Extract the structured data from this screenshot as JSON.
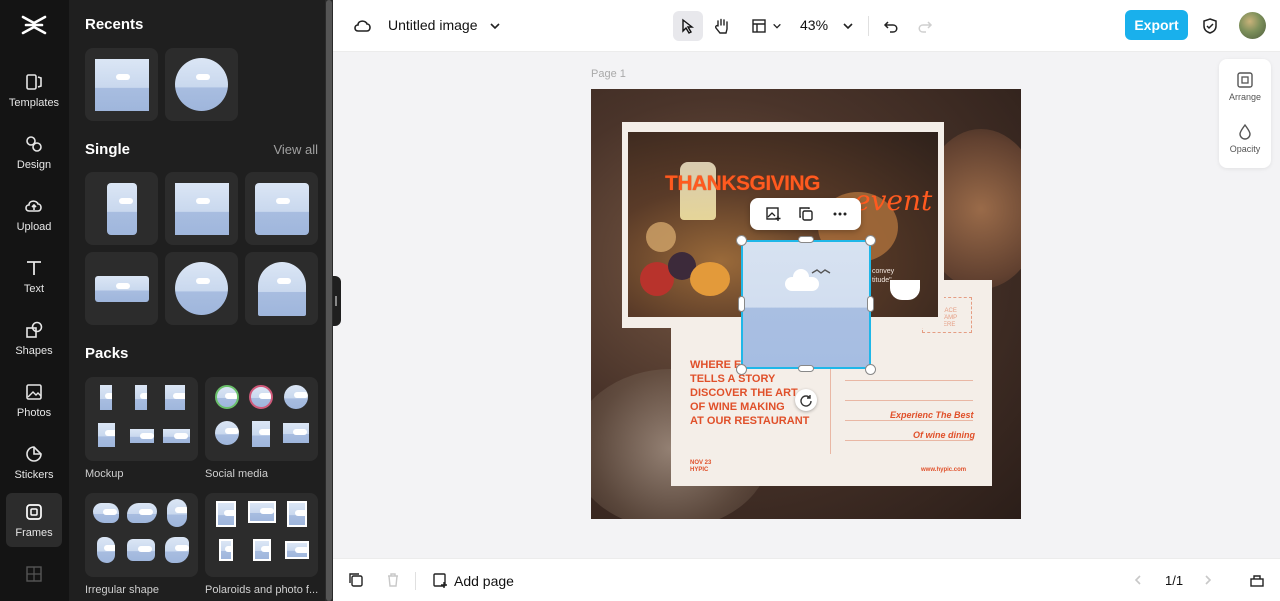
{
  "rail": {
    "items": [
      {
        "label": "Templates",
        "icon": "templates-icon"
      },
      {
        "label": "Design",
        "icon": "design-icon"
      },
      {
        "label": "Upload",
        "icon": "upload-icon"
      },
      {
        "label": "Text",
        "icon": "text-icon"
      },
      {
        "label": "Shapes",
        "icon": "shapes-icon"
      },
      {
        "label": "Photos",
        "icon": "photos-icon"
      },
      {
        "label": "Stickers",
        "icon": "stickers-icon"
      },
      {
        "label": "Frames",
        "icon": "frames-icon"
      }
    ],
    "active": "Frames"
  },
  "panel": {
    "recents_title": "Recents",
    "single_title": "Single",
    "single_view_all": "View all",
    "packs_title": "Packs",
    "packs": [
      {
        "label": "Mockup"
      },
      {
        "label": "Social media"
      },
      {
        "label": "Irregular shape"
      },
      {
        "label": "Polaroids and photo f..."
      }
    ]
  },
  "topbar": {
    "doc_title": "Untitled image",
    "zoom": "43%",
    "export_label": "Export"
  },
  "canvas": {
    "page_label": "Page 1",
    "design": {
      "headline": "THANKSGIVING",
      "script": "event",
      "convey": "convey\ntitude\"",
      "post_lines": [
        "WHERE EVERY",
        "TELLS A STORY",
        "DISCOVER THE ART",
        "OF WINE MAKING",
        "AT OUR RESTAURANT"
      ],
      "experience": "Experienc The Best",
      "wine": "Of wine dining",
      "date": "NOV 23\nHYPIC",
      "website": "www.hypic.com",
      "stamp": "PLACE\nSTAMP\nHERE"
    }
  },
  "side_panel": {
    "arrange": "Arrange",
    "opacity": "Opacity"
  },
  "bottombar": {
    "add_page": "Add page",
    "page_count": "1/1"
  },
  "colors": {
    "accent": "#19b0ec",
    "selection": "#1fb7e8",
    "design_orange": "#ff5a1f"
  }
}
